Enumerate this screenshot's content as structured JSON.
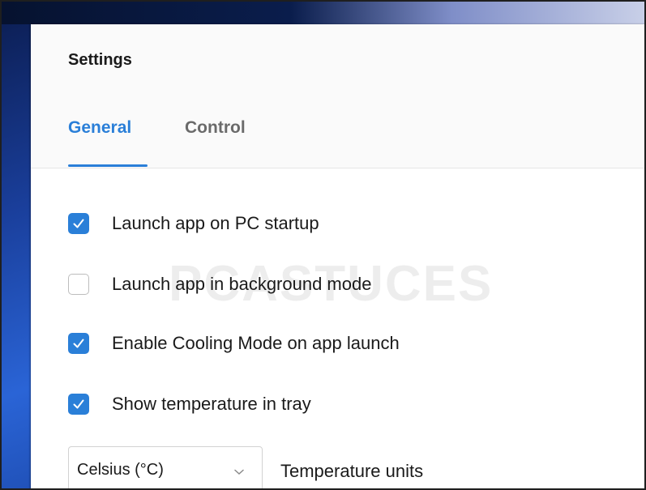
{
  "window": {
    "title": "Settings"
  },
  "tabs": [
    {
      "label": "General",
      "active": true
    },
    {
      "label": "Control",
      "active": false
    }
  ],
  "options": [
    {
      "label": "Launch app on PC startup",
      "checked": true
    },
    {
      "label": "Launch app in background mode",
      "checked": false
    },
    {
      "label": "Enable Cooling Mode on app launch",
      "checked": true
    },
    {
      "label": "Show temperature in tray",
      "checked": true
    }
  ],
  "temperature_units": {
    "selected": "Celsius (°C)",
    "label": "Temperature units"
  },
  "watermark": "PCASTUCES",
  "colors": {
    "accent": "#2a7fd8",
    "header_bg": "#fafafa",
    "text": "#1a1a1a",
    "inactive_tab": "#6a6a6a"
  },
  "icons": {
    "check": "checkmark-icon",
    "dropdown": "chevron-down-icon"
  }
}
